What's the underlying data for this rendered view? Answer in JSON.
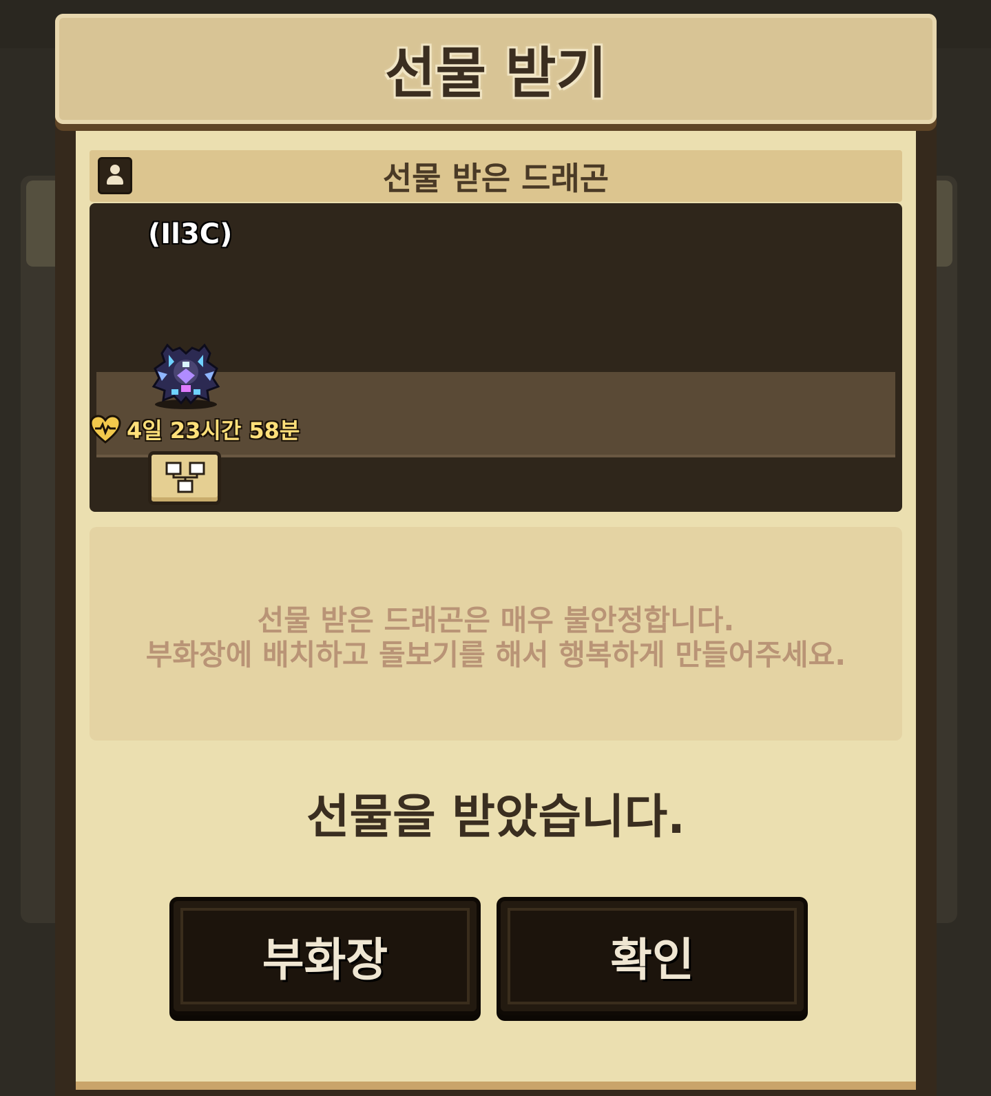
{
  "dialog": {
    "title": "선물 받기",
    "section_title": "선물 받은 드래곤",
    "dragon": {
      "name": "(Il3C)",
      "timer": "4일 23시간 58분"
    },
    "info": {
      "line1": "선물 받은 드래곤은 매우 불안정합니다.",
      "line2": "부화장에 배치하고 돌보기를 해서 행복하게 만들어주세요."
    },
    "received_message": "선물을 받았습니다.",
    "buttons": {
      "hatchery": "부화장",
      "confirm": "확인"
    }
  },
  "icons": [
    "profile-icon",
    "heart-icon",
    "dragon-tree-icon"
  ],
  "colors": {
    "title_bar": "#d8c495",
    "paper": "#ebdfb0",
    "panel_dark": "#2f261b",
    "timer_text": "#ffe07a",
    "info_text": "#b99476",
    "button_bg": "#1c140c"
  }
}
